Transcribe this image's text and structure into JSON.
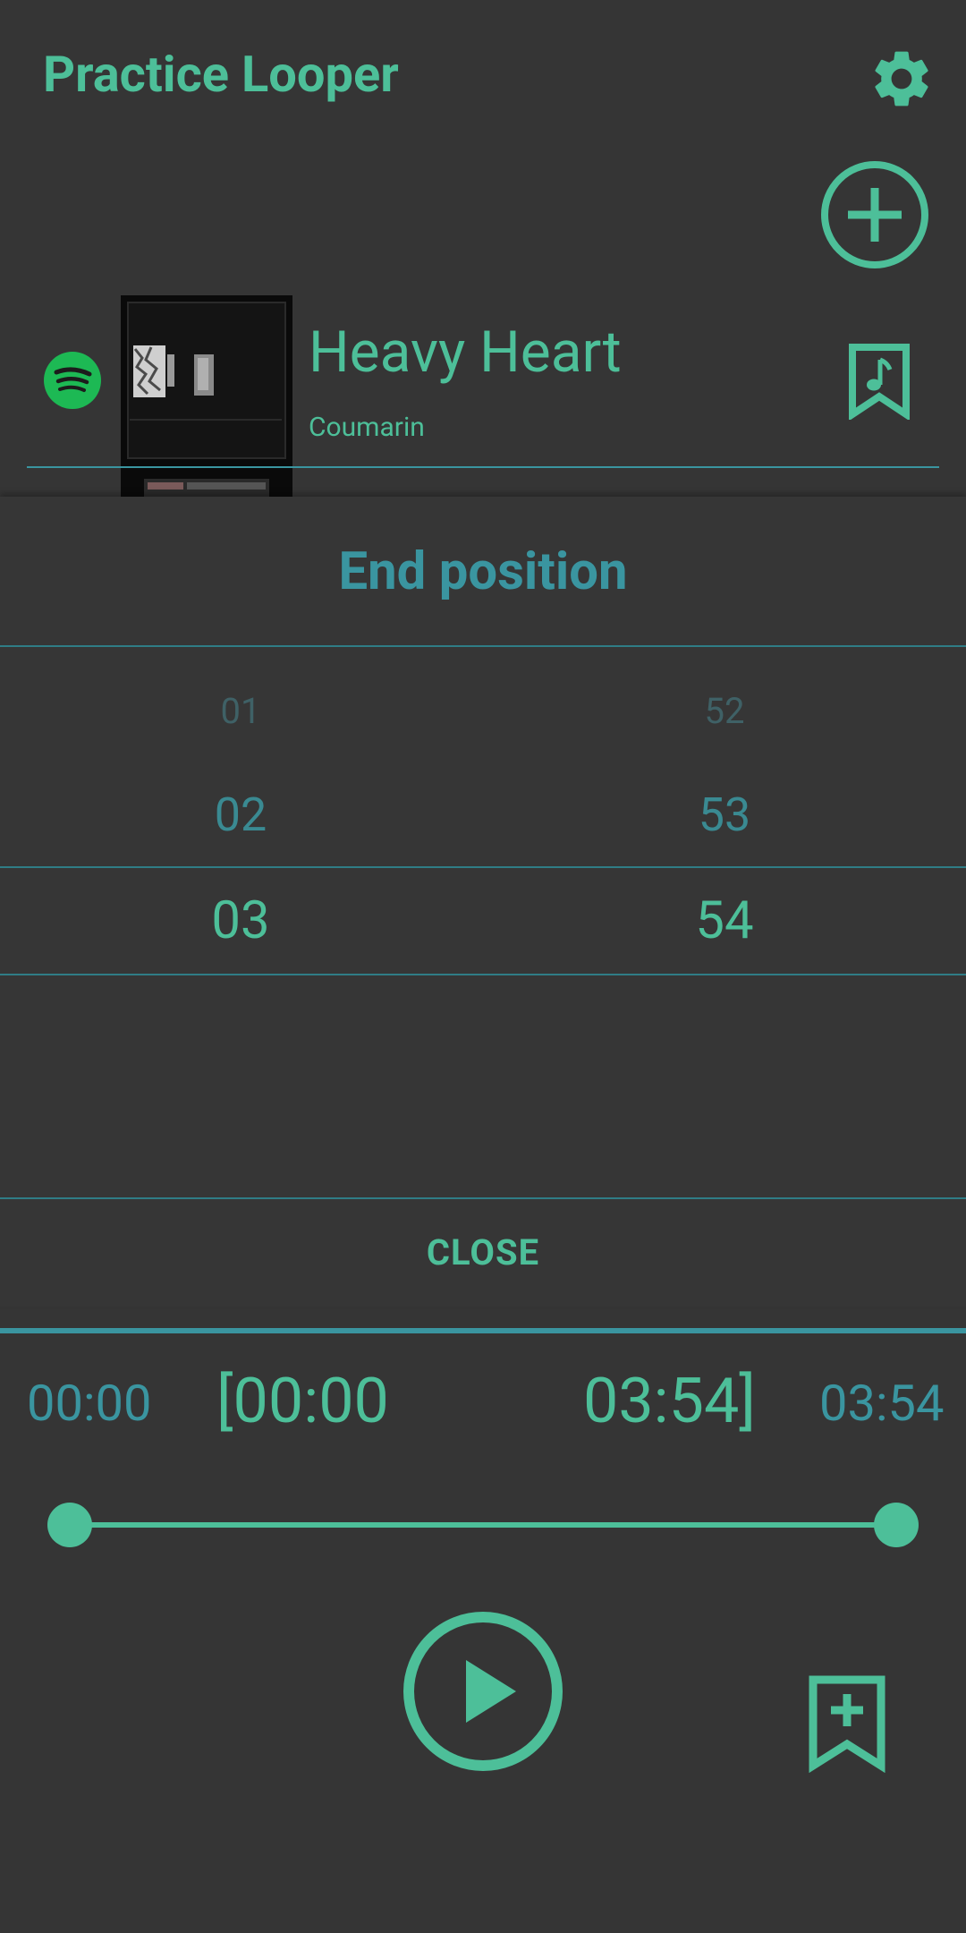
{
  "header": {
    "title": "Practice Looper"
  },
  "song": {
    "title": "Heavy Heart",
    "artist": "Coumarin"
  },
  "dialog": {
    "title": "End position",
    "minutes": [
      "01",
      "02",
      "03"
    ],
    "seconds": [
      "52",
      "53",
      "54"
    ],
    "close_label": "CLOSE"
  },
  "player": {
    "time_start": "00:00",
    "loop_start": "[00:00",
    "loop_end": "03:54]",
    "time_end": "03:54",
    "range": {
      "start_fraction": 0.0,
      "end_fraction": 1.0
    }
  },
  "colors": {
    "background": "#353535",
    "accent_green": "#4dbf99",
    "accent_teal": "#3a95a0",
    "spotify_green": "#1db954"
  },
  "icons": {
    "settings": "gear-icon",
    "add": "plus-circle-icon",
    "spotify": "spotify-icon",
    "bookmark_music": "bookmark-music-icon",
    "play": "play-circle-icon",
    "add_bookmark": "bookmark-plus-icon"
  }
}
